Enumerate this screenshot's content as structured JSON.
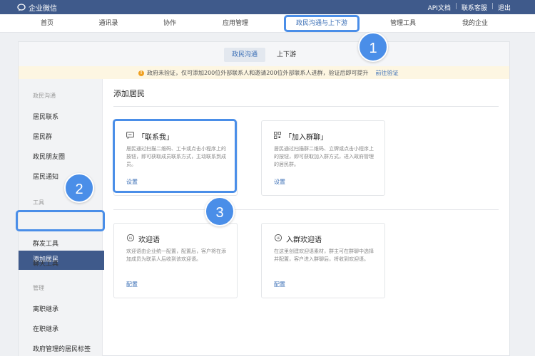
{
  "topbar": {
    "brand": "企业微信",
    "links": [
      "API文档",
      "联系客服",
      "退出"
    ],
    "separator": "|"
  },
  "nav": {
    "items": [
      "首页",
      "通讯录",
      "协作",
      "应用管理",
      "政民沟通与上下游",
      "管理工具",
      "我的企业"
    ],
    "active_index": 4
  },
  "subtabs": {
    "items": [
      "政民沟通",
      "上下游"
    ],
    "active_index": 0
  },
  "notice": {
    "text": "政府未验证，仅可添加200位外部联系人和邀请200位外部联系人进群，验证后即可提升",
    "link": "前往验证"
  },
  "sidebar": {
    "group1": "政民沟通",
    "group1_items": [
      "居民联系",
      "居民群",
      "政民朋友圈",
      "居民通知"
    ],
    "group2": "工具",
    "group2_items": [
      "添加居民",
      "群发工具",
      "聊天工具"
    ],
    "group3": "管理",
    "group3_items": [
      "离职继承",
      "在职继承",
      "政府管理的居民标签"
    ],
    "active_item": "添加居民"
  },
  "content": {
    "title": "添加居民",
    "features": [
      {
        "icon": "message-icon",
        "title": "「联系我」",
        "desc": "居民通过扫描二维码、工卡或点击小程序上的按钮，即可获取成员联系方式，主动联系到成员。",
        "link": "设置"
      },
      {
        "icon": "qrcode-icon",
        "title": "「加入群聊」",
        "desc": "居民通过扫描群二维码、立牌或点击小程序上的按钮，即可获取加入群方式，进入政府管理的居民群。",
        "link": "设置"
      },
      {
        "icon": "hi-icon",
        "title": "欢迎语",
        "desc": "欢迎语由企业统一配置，配置后，客户将在添加成员为联系人后收到该欢迎语。",
        "link": "配置"
      },
      {
        "icon": "hi-group-icon",
        "title": "入群欢迎语",
        "desc": "在这里创建欢迎语素材，群主可在群聊中选择并配置，客户进入群聊后，将收到欢迎语。",
        "link": "配置"
      }
    ]
  },
  "badges": [
    "1",
    "2",
    "3"
  ],
  "colors": {
    "topbar": "#3f5a8b",
    "accent": "#3b6fb6",
    "highlight": "#4a8ee8",
    "notice_bg": "#fdf6e2",
    "warning": "#f0a020"
  }
}
